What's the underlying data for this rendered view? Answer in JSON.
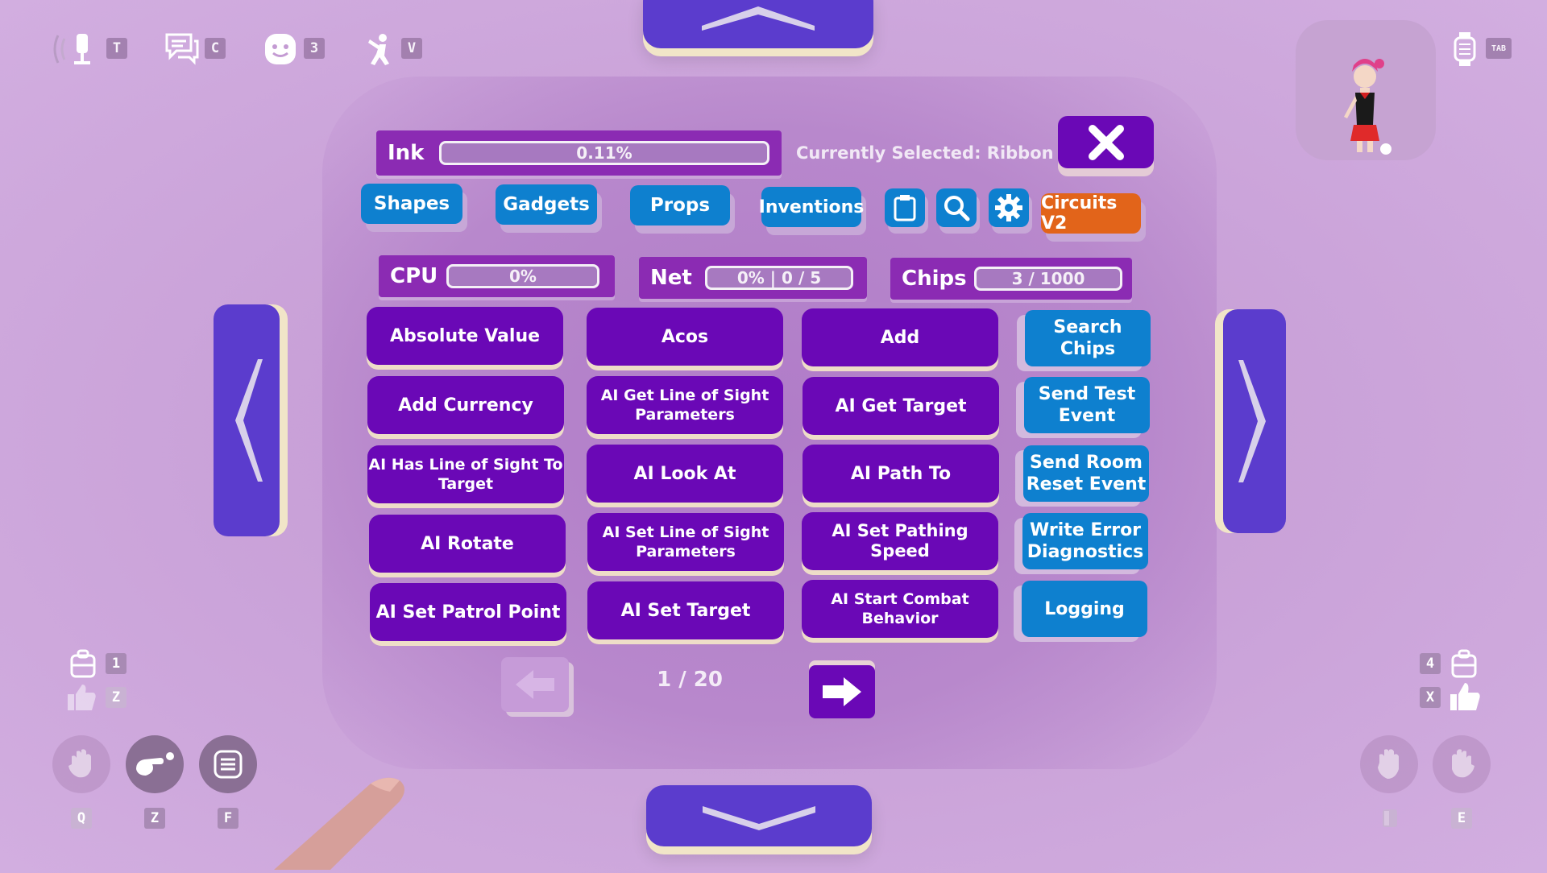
{
  "hud": {
    "top_left": [
      {
        "icon": "microphone-icon",
        "key": "T"
      },
      {
        "icon": "chat-bubbles-icon",
        "key": "C"
      },
      {
        "icon": "emoji-face-icon",
        "key": "3"
      },
      {
        "icon": "pose-figure-icon",
        "key": "V"
      }
    ],
    "watch_key": "TAB",
    "left_bottom": {
      "backpack_key": "1",
      "thumb_key": "Z"
    },
    "right_bottom": {
      "backpack_key": "4",
      "thumb_key": "X"
    },
    "hand_actions": [
      {
        "icon": "wave-hand-icon",
        "key": "Q"
      },
      {
        "icon": "pointer-hand-icon",
        "key": "Z"
      },
      {
        "icon": "menu-list-icon",
        "key": "F"
      }
    ],
    "right_hand_actions": [
      {
        "icon": "grab-hand-icon",
        "key": ""
      },
      {
        "icon": "wave-hand-right-icon",
        "key": "E"
      }
    ]
  },
  "maker_pen": {
    "ink_label": "Ink",
    "ink_value": "0.11%",
    "ink_fraction": 0.0011,
    "selected_text": "Currently Selected: Ribbon",
    "close_icon": "close-x-icon",
    "tabs": [
      "Shapes",
      "Gadgets",
      "Props",
      "Inventions"
    ],
    "tab_icons": [
      "clipboard-icon",
      "search-icon",
      "gear-icon"
    ],
    "active_tab": "Circuits V2",
    "stats": [
      {
        "label": "CPU",
        "value": "0%"
      },
      {
        "label": "Net",
        "value": "0% | 0 / 5"
      },
      {
        "label": "Chips",
        "value": "3 / 1000"
      }
    ],
    "chips": [
      [
        "Absolute Value",
        "Acos",
        "Add"
      ],
      [
        "Add Currency",
        "AI Get Line of Sight Parameters",
        "AI Get Target"
      ],
      [
        "AI Has Line of Sight To Target",
        "AI Look At",
        "AI Path To"
      ],
      [
        "AI Rotate",
        "AI Set Line of Sight Parameters",
        "AI Set Pathing Speed"
      ],
      [
        "AI Set Patrol Point",
        "AI Set Target",
        "AI Start Combat Behavior"
      ]
    ],
    "side_buttons": [
      "Search Chips",
      "Send Test Event",
      "Send Room Reset Event",
      "Write Error Diagnostics",
      "Logging"
    ],
    "page_indicator": "1 / 20",
    "colors": {
      "chip": "#6a08b6",
      "tab": "#0e80cf",
      "active_tab": "#e2641a",
      "nav": "#5b3ccd"
    }
  }
}
